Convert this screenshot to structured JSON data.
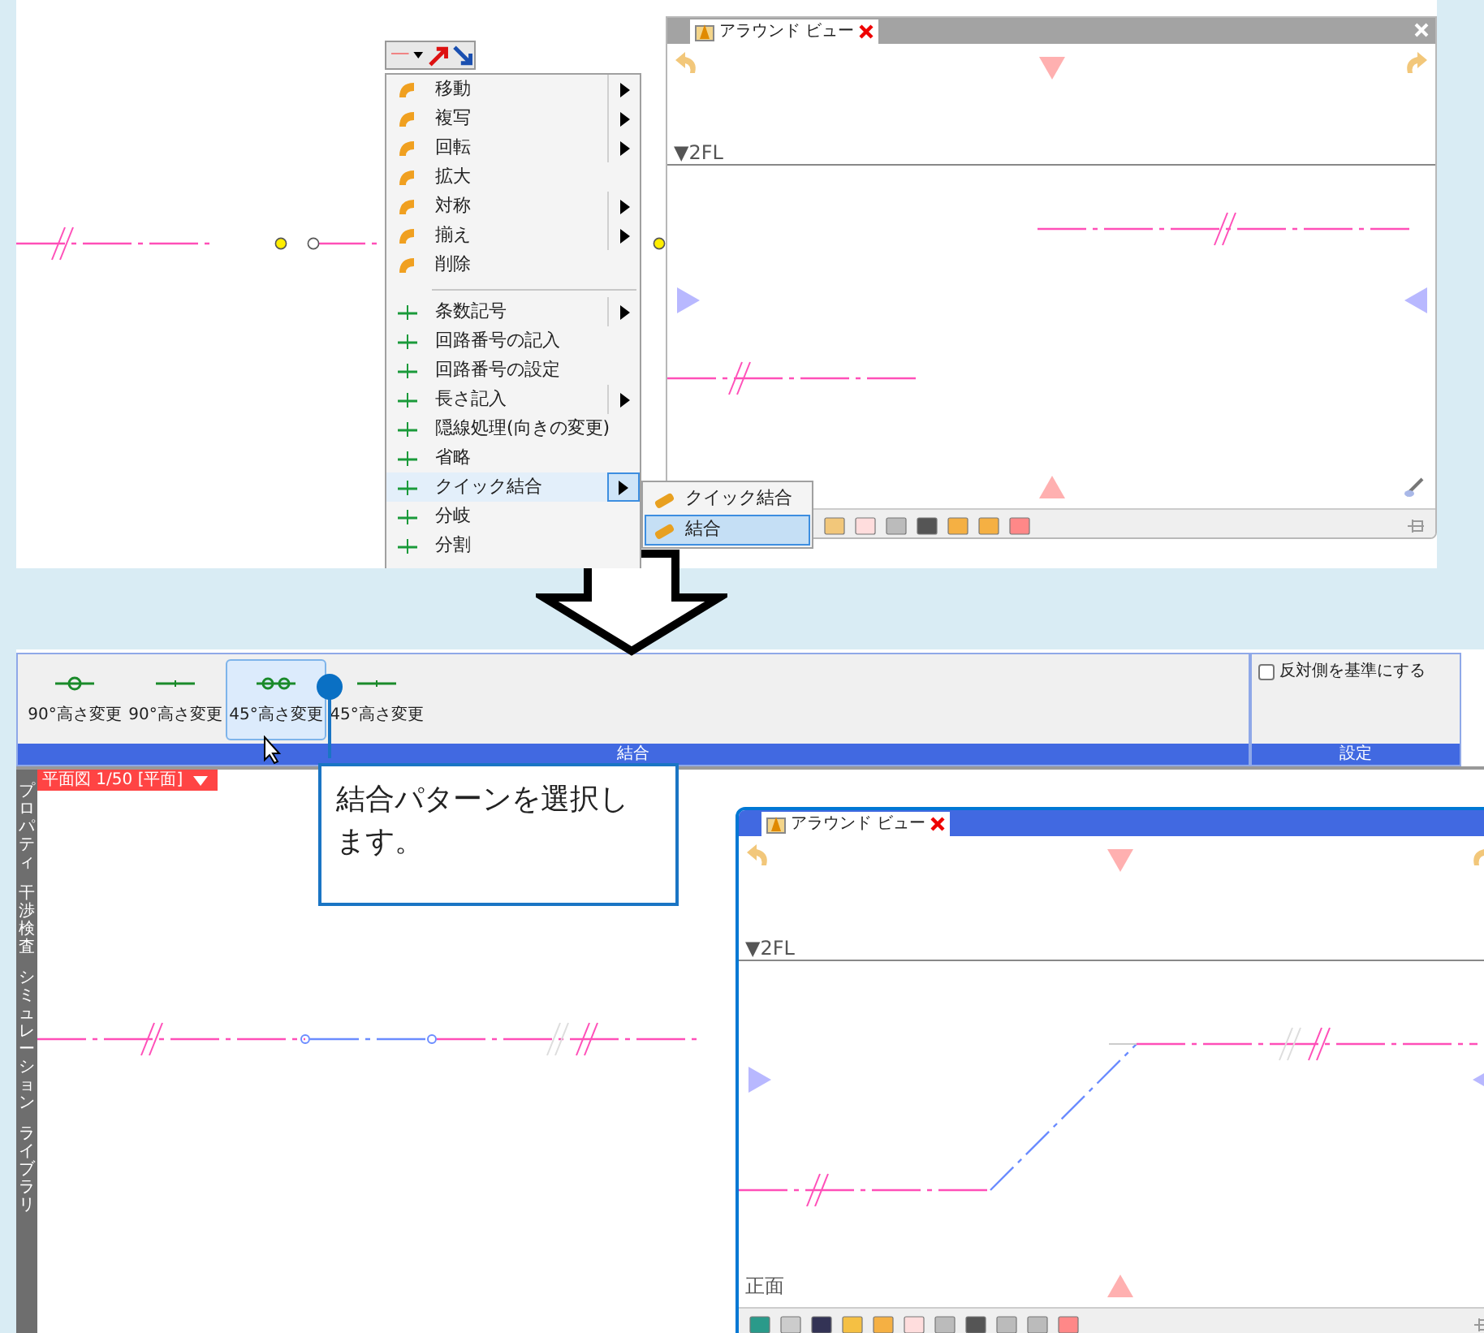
{
  "top": {
    "context_menu": {
      "sections": [
        {
          "items": [
            {
              "label": "移動",
              "submenu": true,
              "selected": false
            },
            {
              "label": "複写",
              "submenu": true,
              "selected": false
            },
            {
              "label": "回転",
              "submenu": true,
              "selected": false
            },
            {
              "label": "拡大",
              "submenu": false,
              "selected": false
            },
            {
              "label": "対称",
              "submenu": true,
              "selected": false
            },
            {
              "label": "揃え",
              "submenu": true,
              "selected": false
            },
            {
              "label": "削除",
              "submenu": false,
              "selected": false
            }
          ]
        },
        {
          "items": [
            {
              "label": "条数記号",
              "submenu": true,
              "selected": false
            },
            {
              "label": "回路番号の記入",
              "submenu": false,
              "selected": false
            },
            {
              "label": "回路番号の設定",
              "submenu": false,
              "selected": false
            },
            {
              "label": "長さ記入",
              "submenu": true,
              "selected": false
            },
            {
              "label": "隠線処理(向きの変更)",
              "submenu": false,
              "selected": false
            },
            {
              "label": "省略",
              "submenu": false,
              "selected": false
            },
            {
              "label": "クイック結合",
              "submenu": true,
              "selected": true
            },
            {
              "label": "分岐",
              "submenu": false,
              "selected": false
            },
            {
              "label": "分割",
              "submenu": false,
              "selected": false
            }
          ]
        }
      ]
    },
    "submenu": {
      "items": [
        {
          "label": "クイック結合",
          "selected": false
        },
        {
          "label": "結合",
          "selected": true
        }
      ]
    },
    "around_view": {
      "tab": "アラウンド ビュー",
      "level_label": "▼2FL"
    }
  },
  "bottom": {
    "ribbon": {
      "groups": [
        {
          "title": "結合",
          "buttons": [
            {
              "label": "90°高さ変更",
              "selected": false
            },
            {
              "label": "90°高さ変更",
              "selected": false
            },
            {
              "label": "45°高さ変更",
              "selected": true
            },
            {
              "label": "45°高さ変更",
              "selected": false
            }
          ]
        },
        {
          "title": "設定",
          "checkbox": {
            "label": "反対側を基準にする",
            "checked": false
          }
        }
      ]
    },
    "view_tab": "平面図 1/50 [平面]",
    "side_tabs": [
      "プロパティ",
      "干渉検査",
      "シミュレーション",
      "ライブラリ"
    ],
    "callout": "結合パターンを選択します。",
    "around_view": {
      "tab": "アラウンド ビュー",
      "level_label": "▼2FL",
      "view_label": "正面"
    }
  }
}
